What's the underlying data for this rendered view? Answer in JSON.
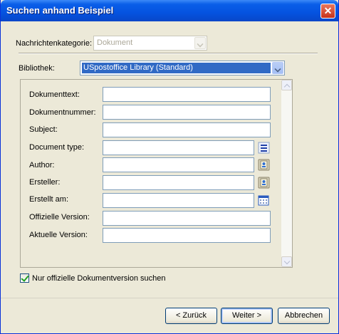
{
  "dialog": {
    "title": "Suchen anhand Beispiel",
    "close_glyph": "✕"
  },
  "category": {
    "label": "Nachrichtenkategorie:",
    "value": "Dokument",
    "disabled": true
  },
  "library": {
    "label": "Bibliothek:",
    "value": "USpostoffice Library  (Standard)"
  },
  "fields": [
    {
      "label": "Dokumenttext:",
      "value": ""
    },
    {
      "label": "Dokumentnummer:",
      "value": ""
    },
    {
      "label": "Subject:",
      "value": ""
    },
    {
      "label": "Document type:",
      "value": "",
      "icon": "list-picker-icon"
    },
    {
      "label": "Author:",
      "value": "",
      "icon": "address-book-icon"
    },
    {
      "label": "Ersteller:",
      "value": "",
      "icon": "address-book-icon"
    },
    {
      "label": "Erstellt am:",
      "value": "",
      "icon": "calendar-icon"
    },
    {
      "label": "Offizielle Version:",
      "value": ""
    },
    {
      "label": "Aktuelle Version:",
      "value": ""
    }
  ],
  "official_only": {
    "label": "Nur offizielle Dokumentversion suchen",
    "checked": true
  },
  "buttons": {
    "back": "< Zurück",
    "next": "Weiter >",
    "cancel": "Abbrechen"
  },
  "colors": {
    "titlebar": "#0553e0",
    "dialog_bg": "#ece9d8",
    "selection": "#316ac5"
  }
}
